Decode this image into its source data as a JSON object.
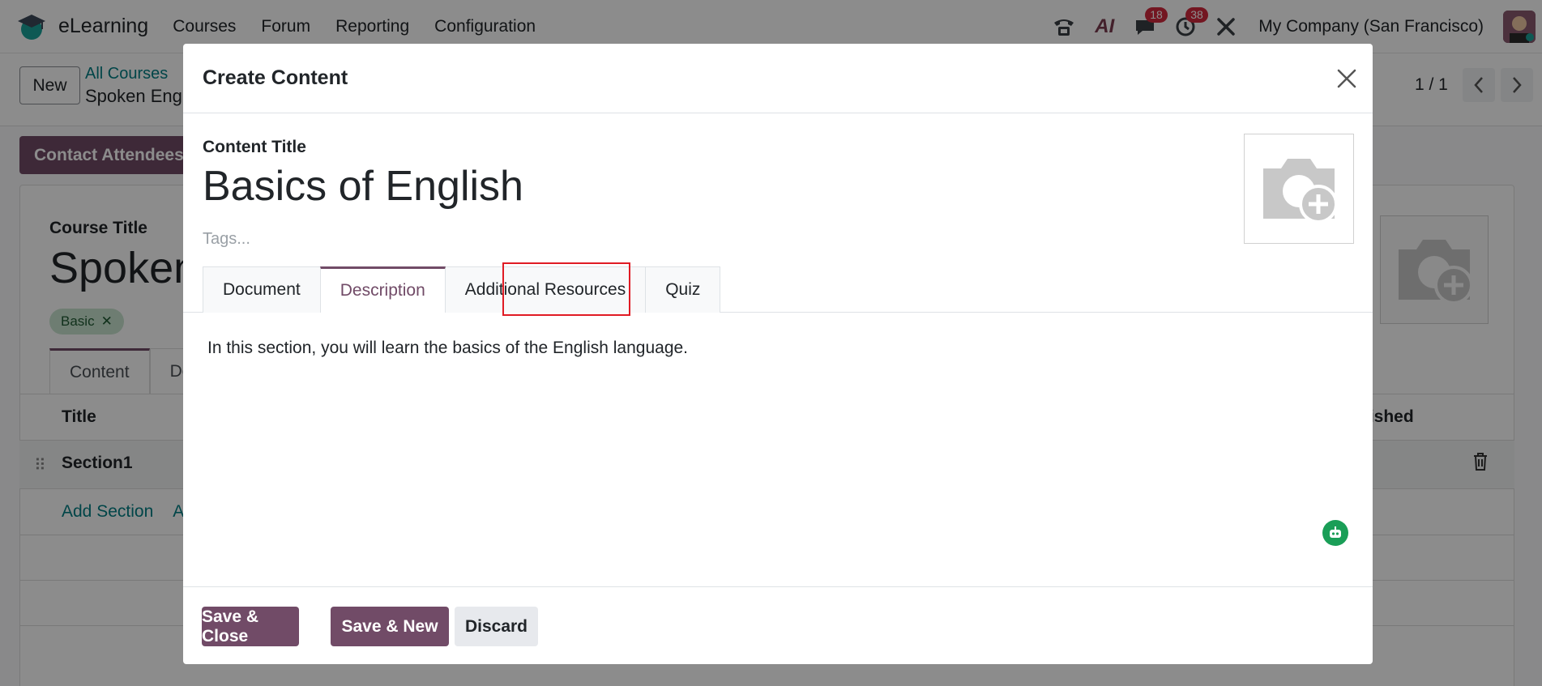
{
  "navbar": {
    "app_name": "eLearning",
    "menu": [
      "Courses",
      "Forum",
      "Reporting",
      "Configuration"
    ],
    "ai_label": "AI",
    "messages_badge": "18",
    "activities_badge": "38",
    "company": "My Company (San Francisco)"
  },
  "control_panel": {
    "new_label": "New",
    "breadcrumb_parent": "All Courses",
    "breadcrumb_current": "Spoken Engli",
    "pager": "1 / 1"
  },
  "form": {
    "contact_attendees": "Contact Attendees",
    "course_title_label": "Course Title",
    "course_title": "Spoken",
    "tag": "Basic",
    "tabs": [
      "Content",
      "De"
    ],
    "columns": {
      "title": "Title",
      "published": "lished"
    },
    "row_title": "Section1",
    "add_section": "Add Section",
    "add_content": "A"
  },
  "modal": {
    "title": "Create Content",
    "content_title_label": "Content Title",
    "content_title": "Basics of English",
    "tags_placeholder": "Tags...",
    "tabs": [
      "Document",
      "Description",
      "Additional Resources",
      "Quiz"
    ],
    "active_tab": "Description",
    "description_text": "In this section, you will learn the basics of the English language.",
    "buttons": {
      "save_close": "Save & Close",
      "save_new": "Save & New",
      "discard": "Discard"
    }
  },
  "colors": {
    "brand": "#714b67",
    "link": "#017e84",
    "badge": "#d1293c",
    "highlight": "#e01b24",
    "bot": "#1a9e57"
  },
  "icons": [
    "app-logo-icon",
    "phone-icon",
    "chat-icon",
    "clock-icon",
    "tools-icon",
    "camera-plus-icon",
    "close-icon",
    "trash-icon",
    "drag-handle-icon",
    "bot-icon",
    "chevron-left-icon",
    "chevron-right-icon"
  ]
}
